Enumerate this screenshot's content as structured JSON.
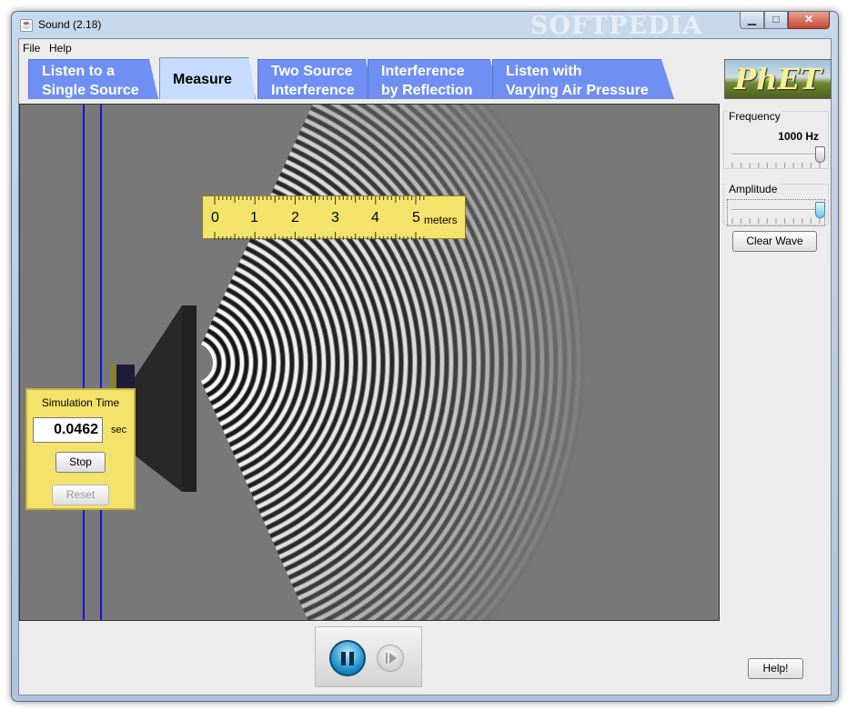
{
  "window": {
    "title": "Sound (2.18)",
    "watermark": "SOFTPEDIA"
  },
  "menu": [
    "File",
    "Help"
  ],
  "tabs": [
    {
      "line1": "Listen to a",
      "line2": "Single Source"
    },
    {
      "line1": "Measure",
      "line2": ""
    },
    {
      "line1": "Two Source",
      "line2": "Interference"
    },
    {
      "line1": "Interference",
      "line2": "by Reflection"
    },
    {
      "line1": "Listen with",
      "line2": "Varying Air Pressure"
    }
  ],
  "selected_tab": "Measure",
  "logo": {
    "text": "PhET"
  },
  "tape_measure": {
    "numbers": [
      "0",
      "1",
      "2",
      "3",
      "4",
      "5"
    ],
    "unit": "meters"
  },
  "sim_time": {
    "title": "Simulation Time",
    "value": "0.0462",
    "unit": "sec",
    "stop_label": "Stop",
    "reset_label": "Reset"
  },
  "controls": {
    "frequency": {
      "label": "Frequency",
      "value_text": "1000 Hz",
      "level": 1.0
    },
    "amplitude": {
      "label": "Amplitude",
      "level": 1.0
    },
    "clear_label": "Clear Wave",
    "help_label": "Help!"
  },
  "playback": {
    "pause_icon": "pause-icon",
    "step_icon": "step-icon"
  }
}
